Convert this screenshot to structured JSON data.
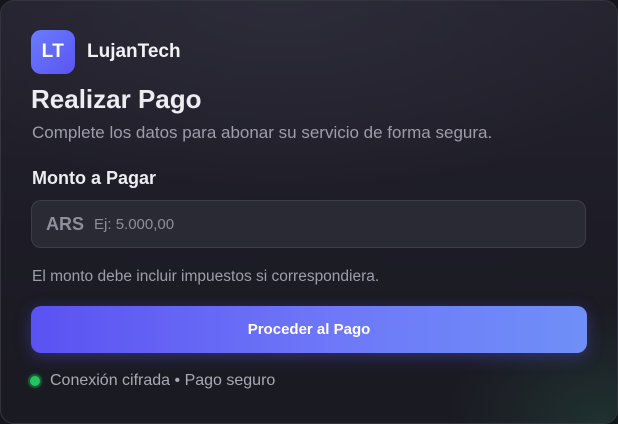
{
  "brand": {
    "logo_initials": "LT",
    "name": "LujanTech",
    "logo_color": "#5f6af6"
  },
  "header": {
    "title": "Realizar Pago",
    "subtitle": "Complete los datos para abonar su servicio de forma segura."
  },
  "amount": {
    "label": "Monto a Pagar",
    "currency": "ARS",
    "placeholder": "Ej: 5.000,00",
    "value": "",
    "hint": "El monto debe incluir impuestos si correspondiera."
  },
  "actions": {
    "submit_label": "Proceder al Pago",
    "accent_color": "#5b52f2"
  },
  "security": {
    "text": "Conexión cifrada • Pago seguro",
    "status_color": "#22c55e"
  }
}
